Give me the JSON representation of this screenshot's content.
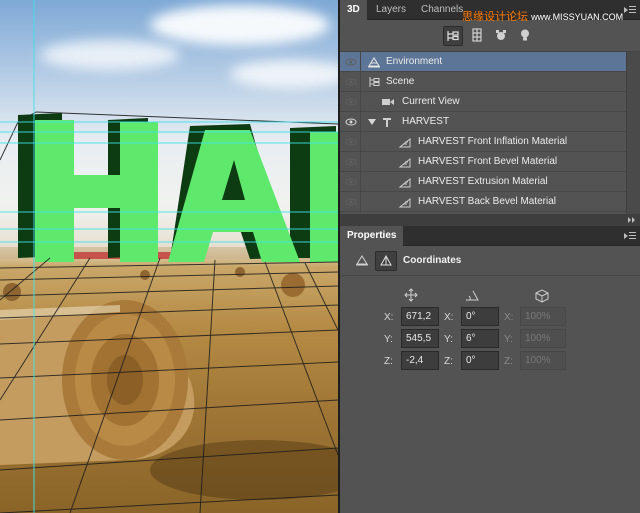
{
  "canvas": {
    "scene_word": "HAR"
  },
  "panel3d": {
    "tabs": [
      "3D",
      "Layers",
      "Channels"
    ],
    "toolbar_icons": [
      "scene-filter-icon",
      "mesh-filter-icon",
      "material-filter-icon",
      "light-filter-icon"
    ],
    "tree": [
      {
        "label": "Environment",
        "icon": "environment-icon",
        "selected": true,
        "indent": 0
      },
      {
        "label": "Scene",
        "icon": "scene-icon",
        "selected": false,
        "indent": 0
      },
      {
        "label": "Current View",
        "icon": "camera-icon",
        "selected": false,
        "indent": 1
      },
      {
        "label": "HARVEST",
        "icon": "mesh-icon",
        "selected": false,
        "indent": 1,
        "expanded": true
      },
      {
        "label": "HARVEST Front Inflation Material",
        "icon": "material-icon",
        "selected": false,
        "indent": 2
      },
      {
        "label": "HARVEST Front Bevel Material",
        "icon": "material-icon",
        "selected": false,
        "indent": 2
      },
      {
        "label": "HARVEST Extrusion Material",
        "icon": "material-icon",
        "selected": false,
        "indent": 2
      },
      {
        "label": "HARVEST Back Bevel Material",
        "icon": "material-icon",
        "selected": false,
        "indent": 2
      }
    ]
  },
  "properties": {
    "tab": "Properties",
    "title": "Coordinates",
    "columns": [
      "move-icon",
      "rotate-icon",
      "scale-icon"
    ],
    "rows": [
      {
        "axis": "X:",
        "position": "671,2",
        "rotation": "0°",
        "scale": "100%"
      },
      {
        "axis": "Y:",
        "position": "545,5",
        "rotation": "6°",
        "scale": "100%"
      },
      {
        "axis": "Z:",
        "position": "-2,4",
        "rotation": "0°",
        "scale": "100%"
      }
    ]
  },
  "watermark": {
    "text": "思缘设计论坛",
    "url": "www.MISSYUAN.COM"
  },
  "colors": {
    "selection": "#5d7596",
    "panel_bg": "#535353",
    "letter_green": "#5ee86c",
    "guide_cyan": "#3ee3ea"
  }
}
